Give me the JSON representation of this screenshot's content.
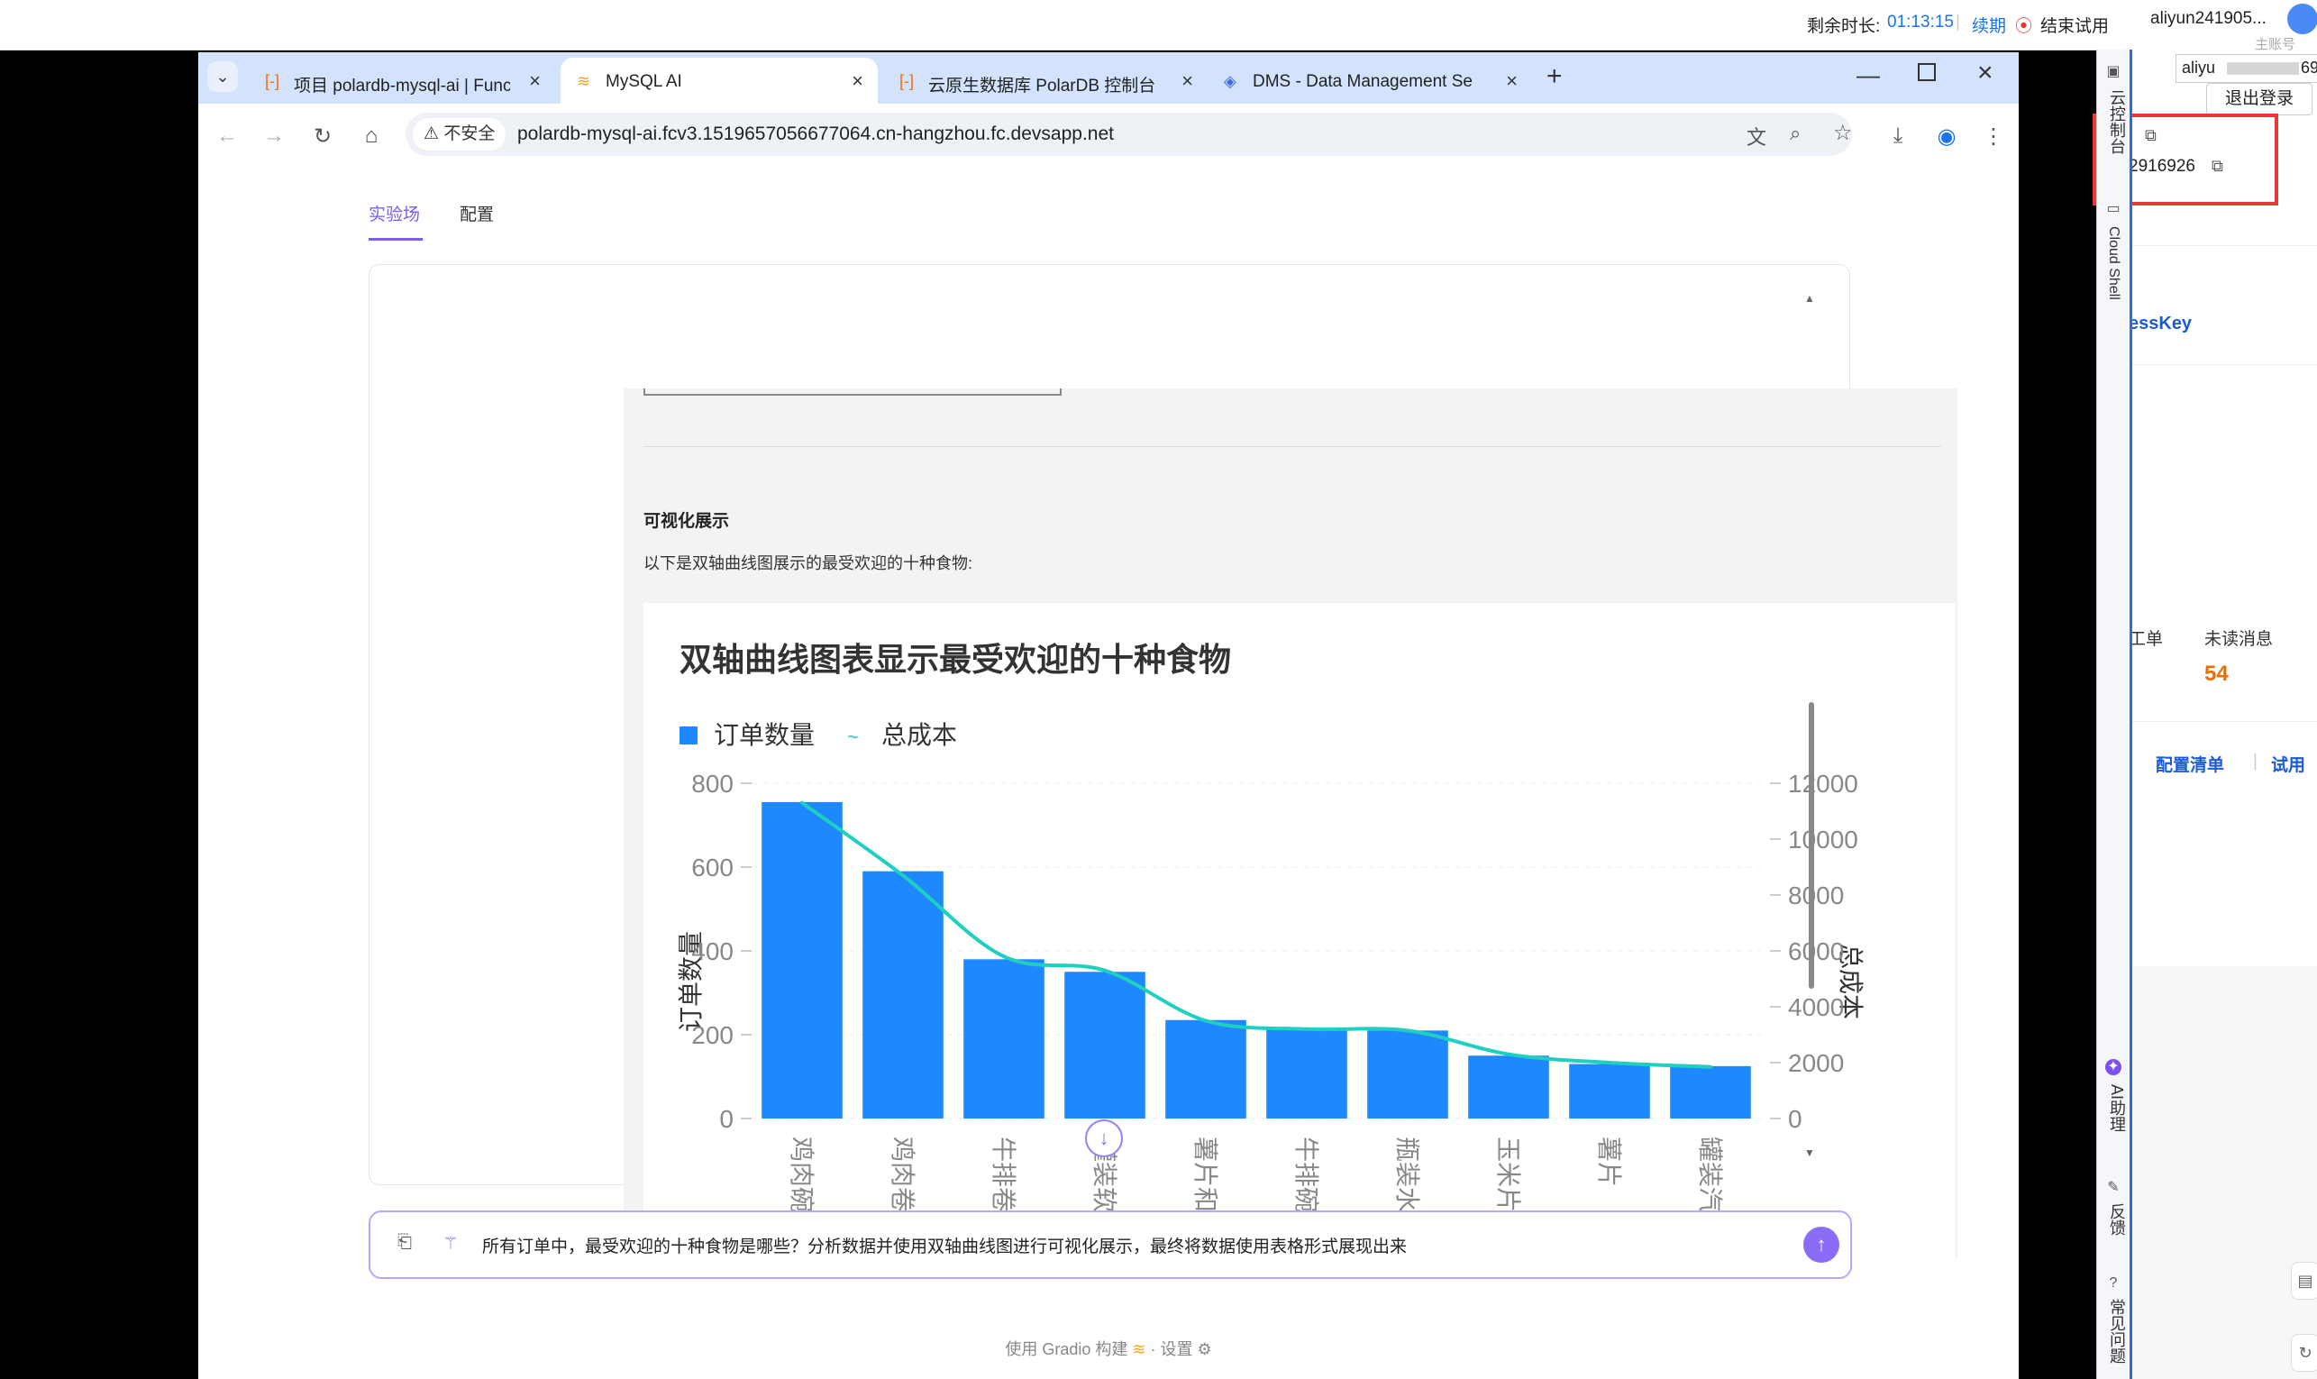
{
  "lab_bar": {
    "remaining_label": "剩余时长:",
    "remaining_time": "01:13:15",
    "renew": "续期",
    "end_trial": "结束试用"
  },
  "console_panel": {
    "account_name": "aliyun241905...",
    "sub_account": "主账号",
    "account_partial": "aliyu",
    "account_suffix": "69",
    "logout": "退出登录",
    "account_id": "2916926",
    "access_key": "essKey",
    "work_order": "工单",
    "unread_label": "未读消息",
    "unread_count": "54",
    "config_list": "配置清单",
    "trial": "试用"
  },
  "side_rail": {
    "console": "云控制台",
    "cloud_shell": "Cloud Shell",
    "ai_assistant": "AI助理",
    "feedback": "反馈",
    "faq": "常见问题"
  },
  "browser": {
    "tabs": [
      {
        "label": "项目 polardb-mysql-ai | Funct",
        "icon": "bracket-icon",
        "active": false
      },
      {
        "label": "MySQL AI",
        "icon": "gradio-icon",
        "active": true
      },
      {
        "label": "云原生数据库 PolarDB 控制台",
        "icon": "bracket-icon",
        "active": false
      },
      {
        "label": "DMS - Data Management Se",
        "icon": "dms-icon",
        "active": false
      }
    ],
    "security": "不安全",
    "url": "polardb-mysql-ai.fcv3.1519657056677064.cn-hangzhou.fc.devsapp.net"
  },
  "page": {
    "tabs": [
      "实验场",
      "配置"
    ],
    "section_title": "可视化展示",
    "section_desc": "以下是双轴曲线图展示的最受欢迎的十种食物:",
    "input_text": "所有订单中，最受欢迎的十种食物是哪些？分析数据并使用双轴曲线图进行可视化展示，最终将数据使用表格形式展现出来",
    "footer_built": "使用 Gradio 构建",
    "footer_sep": "·",
    "footer_settings": "设置"
  },
  "colors": {
    "bar": "#1e88ff",
    "line": "#1fcfc0",
    "accent": "#8b6cf6",
    "tab_bg": "#d3e3fd"
  },
  "chart_data": {
    "type": "bar",
    "title": "双轴曲线图表显示最受欢迎的十种食物",
    "categories": [
      "鸡肉碗",
      "鸡肉卷饭",
      "牛排卷饼",
      "罐装软饮",
      "薯片和鳄梨酱",
      "牛排碗",
      "瓶装水",
      "玉米片和莎莎酱",
      "薯片",
      "罐装汽水"
    ],
    "category_display": [
      "鸡肉碗",
      "鸡肉卷‹",
      "牛排卷‹",
      "罐装软‹",
      "薯片和‹",
      "牛排碗",
      "瓶装水",
      "玉米片和",
      "薯片",
      "罐装汽‹"
    ],
    "series": [
      {
        "name": "订单数量",
        "type": "bar",
        "axis": "left",
        "values": [
          755,
          590,
          380,
          350,
          235,
          215,
          210,
          150,
          130,
          125
        ]
      },
      {
        "name": "总成本",
        "type": "line",
        "axis": "right",
        "values": [
          11300,
          8700,
          5800,
          5300,
          3500,
          3200,
          3150,
          2300,
          2000,
          1850
        ]
      }
    ],
    "ylabel": "订单数量",
    "y2label": "总成本",
    "ylim": [
      0,
      800
    ],
    "y2lim": [
      0,
      12000
    ],
    "yticks": [
      "0",
      "200",
      "400",
      "600",
      "800"
    ],
    "y2ticks": [
      "0",
      "2000",
      "4000",
      "6000",
      "8000",
      "10000",
      "12000"
    ],
    "legend_position": "top-left",
    "grid": true
  }
}
